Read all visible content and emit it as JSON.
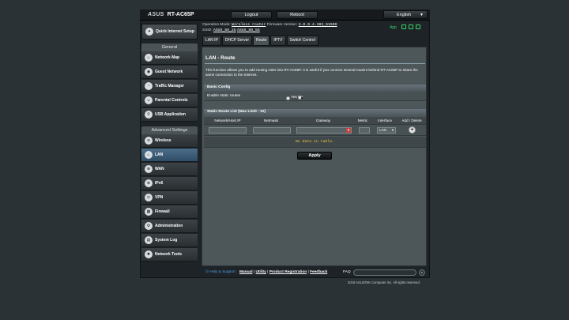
{
  "header": {
    "brand": "ASUS",
    "model": "RT-AC65P",
    "logout_label": "Logout",
    "reboot_label": "Reboot",
    "language": "English"
  },
  "status": {
    "operation_mode_label": "Operation Mode:",
    "operation_mode_value": "Wireless router",
    "firmware_label": "Firmware Version:",
    "firmware_value": "3.0.0.4.382_51599",
    "ssid_label": "SSID:",
    "ssid_1": "ASUS_88_2G",
    "ssid_2": "ASUS_88_5G",
    "app_label": "App"
  },
  "sidebar": {
    "quick_setup": "Quick Internet Setup",
    "general_header": "General",
    "general_items": [
      {
        "label": "Network Map",
        "icon": "network-map-icon"
      },
      {
        "label": "Guest Network",
        "icon": "guest-network-icon"
      },
      {
        "label": "Traffic Manager",
        "icon": "traffic-manager-icon"
      },
      {
        "label": "Parental Controls",
        "icon": "parental-controls-icon"
      },
      {
        "label": "USB Application",
        "icon": "usb-icon"
      }
    ],
    "advanced_header": "Advanced Settings",
    "advanced_items": [
      {
        "label": "Wireless",
        "icon": "wireless-icon"
      },
      {
        "label": "LAN",
        "icon": "lan-icon"
      },
      {
        "label": "WAN",
        "icon": "wan-icon"
      },
      {
        "label": "IPv6",
        "icon": "ipv6-icon"
      },
      {
        "label": "VPN",
        "icon": "vpn-icon"
      },
      {
        "label": "Firewall",
        "icon": "firewall-icon"
      },
      {
        "label": "Administration",
        "icon": "administration-icon"
      },
      {
        "label": "System Log",
        "icon": "system-log-icon"
      },
      {
        "label": "Network Tools",
        "icon": "network-tools-icon"
      }
    ],
    "active_item": "LAN"
  },
  "tabs": [
    "LAN IP",
    "DHCP Server",
    "Route",
    "IPTV",
    "Switch Control"
  ],
  "active_tab": "Route",
  "main": {
    "title": "LAN - Route",
    "description": "This function allows you to add routing rules into RT-AC65P. It is useful if you connect several routers behind RT-AC65P to share the same connection to the Internet.",
    "basic_config_header": "Basic Config",
    "enable_static_label": "Enable static routes",
    "radio_yes": "Yes",
    "radio_no": "No",
    "radio_selected": "No",
    "route_list_header": "Static Route List (Max Limit : 32)",
    "columns": [
      "Network/Host IP",
      "Netmask",
      "Gateway",
      "Metric",
      "Interface",
      "Add / Delete"
    ],
    "interface_value": "LAN",
    "no_data": "No data in table.",
    "apply_label": "Apply"
  },
  "footer": {
    "help_support": "Help & Support",
    "manual": "Manual",
    "utility": "Utility",
    "product_registration": "Product Registration",
    "feedback": "Feedback",
    "separator": "|",
    "faq": "FAQ",
    "copyright": "2019 ASUSTeK Computer Inc. All rights reserved."
  },
  "colors": {
    "accent_active": "#3f6685",
    "nodata_text": "#f6c444",
    "status_green": "#3bd36b"
  }
}
